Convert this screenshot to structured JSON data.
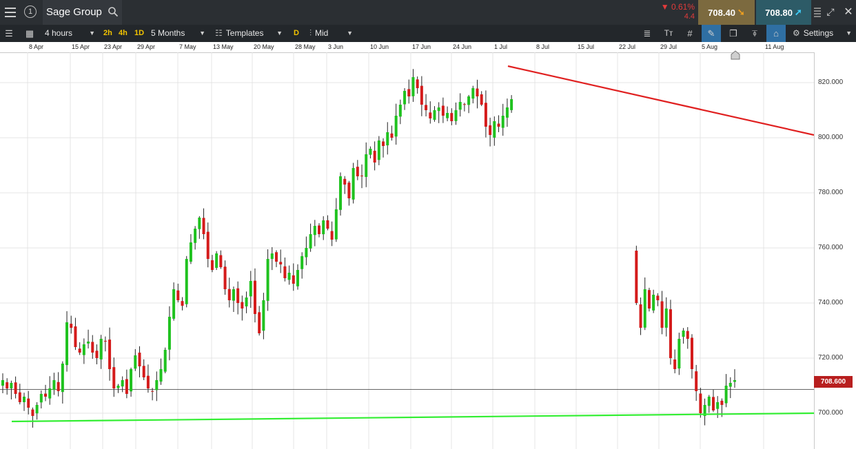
{
  "header": {
    "menu_icon": "hamburger-icon",
    "info_badge": "1",
    "instrument": "Sage Group",
    "search_icon": "search-icon",
    "change_pct": "0.61%",
    "change_points": "4.4",
    "change_direction": "down",
    "sell_price": "708.40",
    "buy_price": "708.80",
    "colors": {
      "sell_bg": "#7c6a3f",
      "buy_bg": "#2d5b67",
      "negative": "#e23b3b"
    }
  },
  "toolbar": {
    "interval": "4 hours",
    "quick_intervals": [
      "2h",
      "4h",
      "1D"
    ],
    "range": "5 Months",
    "templates_label": "Templates",
    "d_label": "D",
    "price_type": "Mid",
    "settings_label": "Settings"
  },
  "date_axis": [
    "8 Apr",
    "15 Apr",
    "23 Apr",
    "29 Apr",
    "7 May",
    "13 May",
    "20 May",
    "28 May",
    "3 Jun",
    "10 Jun",
    "17 Jun",
    "24 Jun",
    "1 Jul",
    "8 Jul",
    "15 Jul",
    "22 Jul",
    "29 Jul",
    "5 Aug",
    "11 Aug"
  ],
  "price_axis": [
    "820.000",
    "800.000",
    "780.000",
    "760.000",
    "740.000",
    "720.000",
    "700.000"
  ],
  "current_price_tag": "708.600",
  "chart_data": {
    "type": "candlestick",
    "y_unit": "GBp",
    "ylim": [
      687,
      831
    ],
    "grid": true,
    "up_color": "#1fc21f",
    "down_color": "#d41b1b",
    "current_price": 708.6,
    "trendlines": [
      {
        "name": "resistance",
        "color": "#e02020",
        "from": {
          "date": "1 Jul",
          "price": 826
        },
        "to": {
          "date": "right edge",
          "price": 801
        }
      },
      {
        "name": "support",
        "color": "#33ee33",
        "from": {
          "date": "8 Apr",
          "price": 697
        },
        "to": {
          "date": "right edge",
          "price": 700
        }
      }
    ],
    "path_close": [
      712,
      709,
      711,
      707,
      704,
      706,
      702,
      699,
      703,
      707,
      706,
      709,
      712,
      708,
      718,
      733,
      731,
      724,
      722,
      725,
      726,
      722,
      720,
      727,
      726,
      716,
      709,
      710,
      712,
      707,
      716,
      721,
      717,
      713,
      709,
      708,
      712,
      716,
      723,
      735,
      745,
      741,
      739,
      756,
      762,
      767,
      771,
      765,
      756,
      752,
      758,
      753,
      745,
      741,
      745,
      740,
      738,
      742,
      748,
      736,
      729,
      741,
      756,
      758,
      755,
      754,
      749,
      751,
      747,
      752,
      757,
      760,
      765,
      768,
      765,
      770,
      767,
      763,
      774,
      786,
      783,
      778,
      789,
      786,
      786,
      794,
      796,
      791,
      799,
      797,
      802,
      800,
      808,
      812,
      817,
      815,
      822,
      818,
      812,
      810,
      807,
      810,
      811,
      808,
      809,
      806,
      810,
      813,
      812,
      815,
      818,
      815,
      812,
      804,
      801,
      806,
      804,
      808,
      811,
      814,
      740,
      731,
      745,
      738,
      743,
      741,
      731,
      738,
      720,
      716,
      727,
      730,
      727,
      716,
      708,
      700,
      703,
      706,
      701,
      704,
      703,
      710,
      711,
      712
    ],
    "break_after_index": 119
  }
}
